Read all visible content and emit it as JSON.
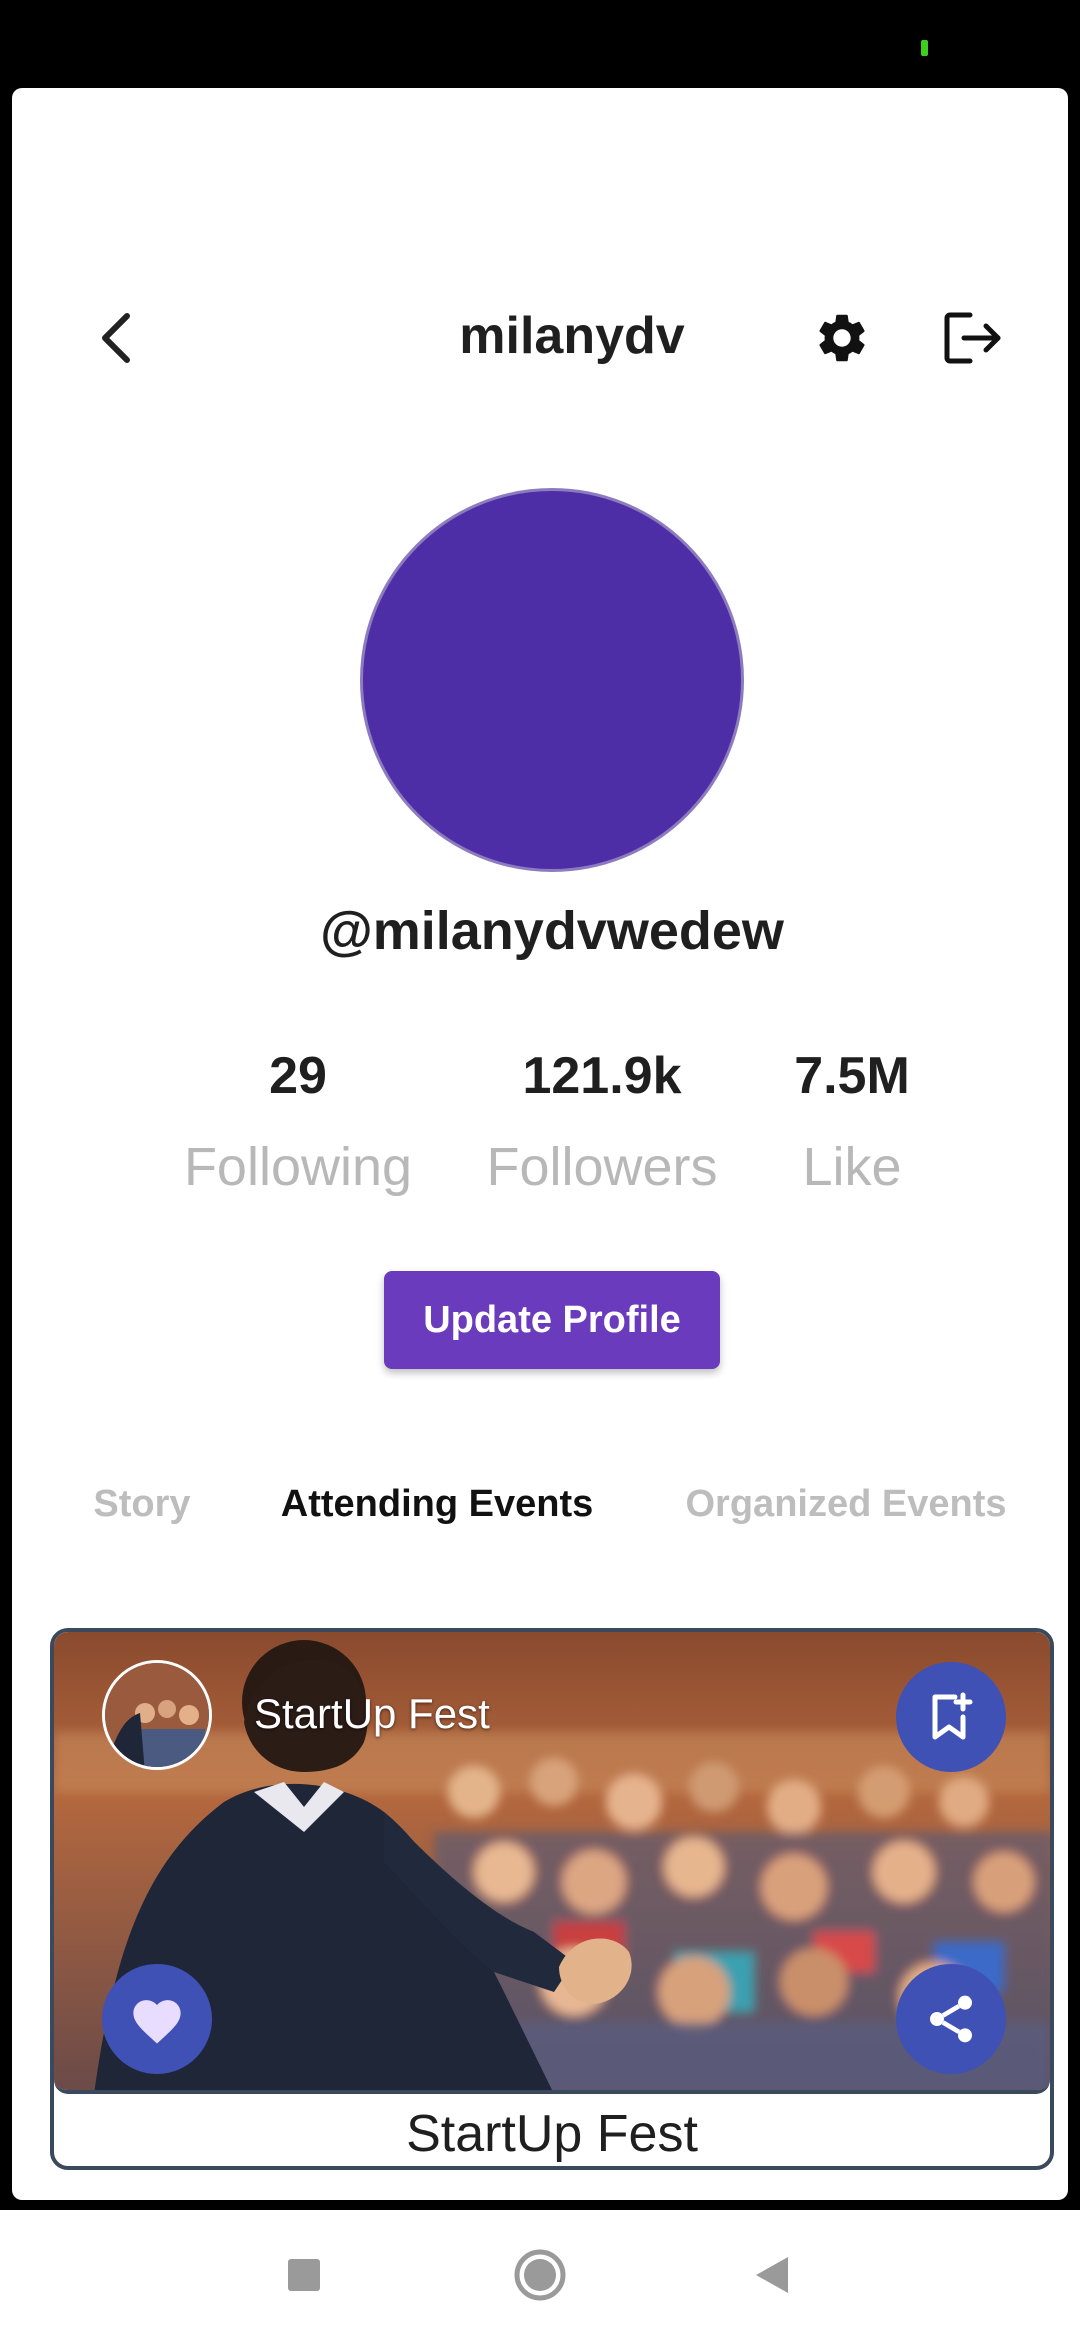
{
  "header": {
    "title": "milanydv",
    "back_icon": "chevron-left-icon",
    "settings_icon": "gear-icon",
    "logout_icon": "logout-icon"
  },
  "profile": {
    "avatar_color": "#4e2ea6",
    "handle": "@milanydvwedew",
    "stats": {
      "following": {
        "value": "29",
        "label": "Following"
      },
      "followers": {
        "value": "121.9k",
        "label": "Followers"
      },
      "like": {
        "value": "7.5M",
        "label": "Like"
      }
    },
    "update_button": "Update Profile",
    "accent_color": "#6a3bbd"
  },
  "tabs": [
    {
      "label": "Story",
      "active": false
    },
    {
      "label": "Attending Events",
      "active": true
    },
    {
      "label": "Organized Events",
      "active": false
    }
  ],
  "events": [
    {
      "title": "StartUp Fest",
      "overlay_title": "StartUp Fest",
      "bookmark_icon": "bookmark-add-icon",
      "like_icon": "heart-icon",
      "share_icon": "share-icon",
      "fab_color": "#3f51b5"
    }
  ],
  "navigation": {
    "recents_icon": "square-icon",
    "home_icon": "circle-icon",
    "back_icon": "triangle-back-icon"
  }
}
